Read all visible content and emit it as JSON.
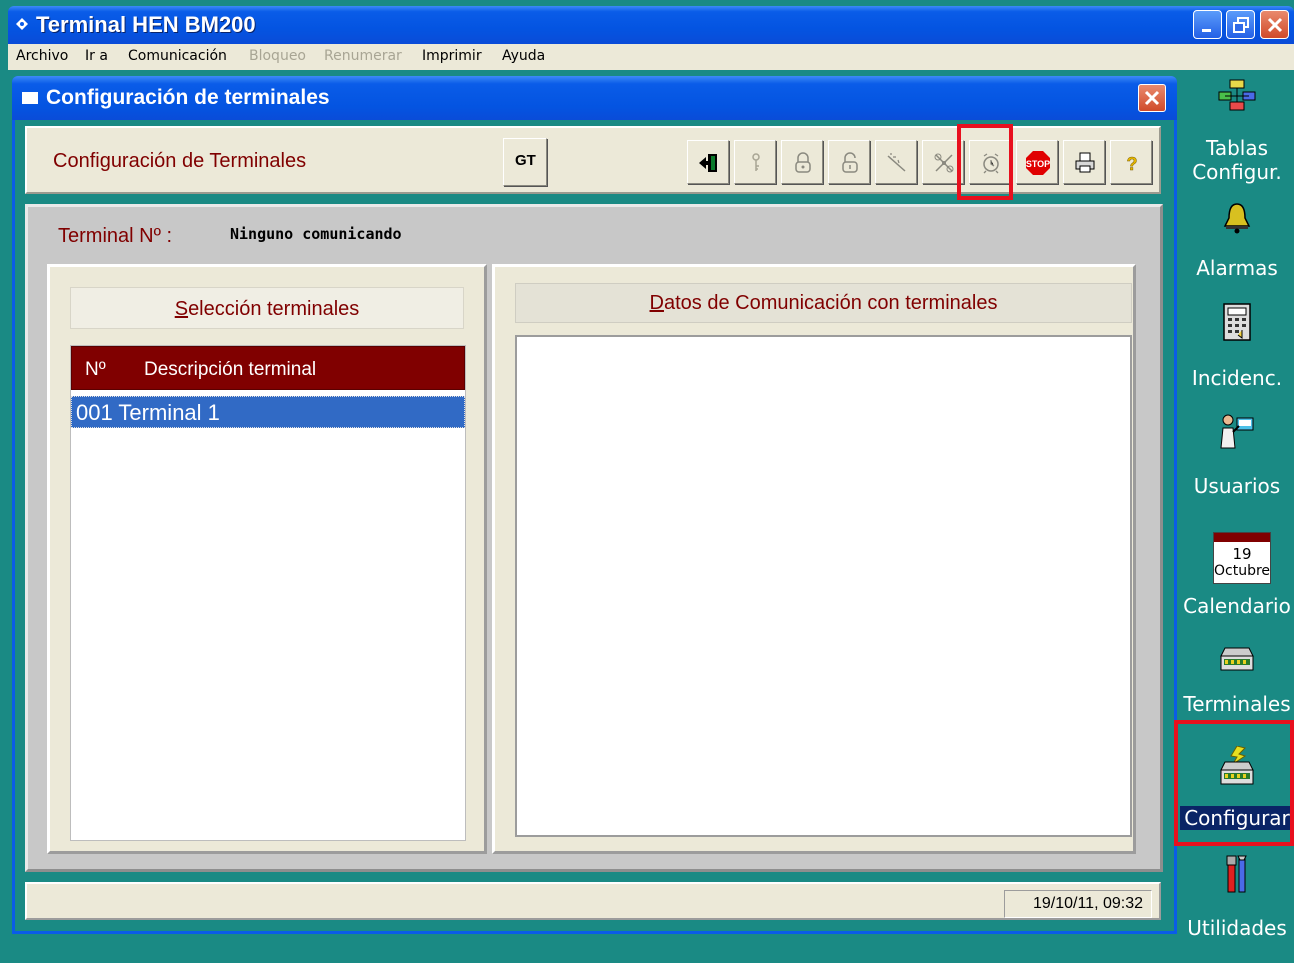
{
  "window": {
    "title": "Terminal HEN BM200"
  },
  "menu": {
    "items": [
      {
        "label": "Archivo",
        "enabled": true
      },
      {
        "label": "Ir a",
        "enabled": true
      },
      {
        "label": "Comunicación",
        "enabled": true
      },
      {
        "label": "Bloqueo",
        "enabled": false
      },
      {
        "label": "Renumerar",
        "enabled": false
      },
      {
        "label": "Imprimir",
        "enabled": true
      },
      {
        "label": "Ayuda",
        "enabled": true
      }
    ]
  },
  "child_window": {
    "title": "Configuración de terminales"
  },
  "toolbar": {
    "label": "Configuración de Terminales",
    "gt_label": "GT",
    "buttons": [
      {
        "icon": "exit-icon",
        "enabled": true
      },
      {
        "icon": "key-icon",
        "enabled": false
      },
      {
        "icon": "lock-icon",
        "enabled": false
      },
      {
        "icon": "unlock-icon",
        "enabled": false
      },
      {
        "icon": "wand-icon",
        "enabled": false
      },
      {
        "icon": "tools-icon",
        "enabled": false
      },
      {
        "icon": "alarm-clock-icon",
        "enabled": false
      },
      {
        "icon": "stop-icon",
        "enabled": true
      },
      {
        "icon": "printer-icon",
        "enabled": true
      },
      {
        "icon": "help-icon",
        "enabled": true
      }
    ],
    "stop_text": "STOP",
    "help_text": "?"
  },
  "terminal": {
    "label": "Terminal Nº :",
    "value": "Ninguno comunicando"
  },
  "selection": {
    "header": "Selección terminales",
    "columns": [
      "Nº",
      "Descripción terminal"
    ],
    "rows": [
      {
        "text": "001 Terminal 1",
        "selected": true
      }
    ]
  },
  "comm_data": {
    "header": "Datos de Comunicación con terminales"
  },
  "status": {
    "timestamp": "19/10/11, 09:32"
  },
  "sidebar": {
    "items": [
      {
        "label": "Tablas",
        "label2": "Configur.",
        "icon": "tables-icon"
      },
      {
        "label": "Alarmas",
        "icon": "bell-icon"
      },
      {
        "label": "Incidenc.",
        "icon": "calculator-icon"
      },
      {
        "label": "Usuarios",
        "icon": "user-terminal-icon"
      },
      {
        "label": "Calendario",
        "icon": "calendar-icon",
        "day": "19",
        "month": "Octubre"
      },
      {
        "label": "Terminales",
        "icon": "terminal-device-icon"
      },
      {
        "label": "Configurar",
        "icon": "configure-terminal-icon",
        "active": true
      },
      {
        "label": "Utilidades",
        "icon": "utilities-icon"
      }
    ]
  },
  "colors": {
    "accent_maroon": "#800000",
    "desktop_teal": "#1a8a84",
    "xp_blue": "#0a5ce8",
    "selection_blue": "#316ac5",
    "highlight_red": "#e8101e"
  }
}
